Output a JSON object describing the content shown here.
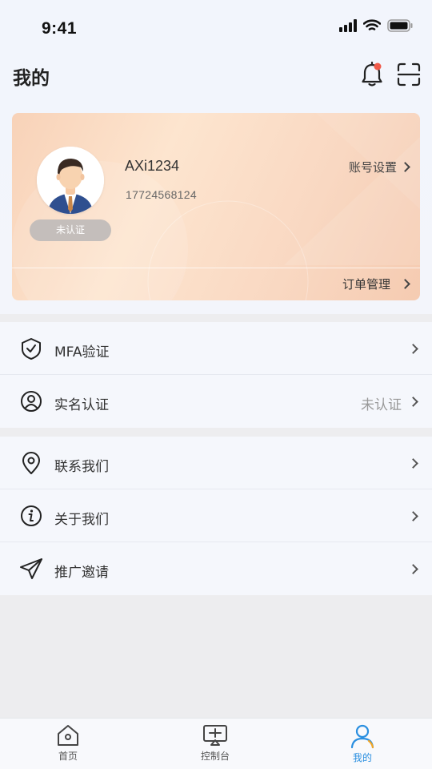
{
  "status_bar": {
    "time": "9:41"
  },
  "header": {
    "title": "我的",
    "bell_has_badge": true
  },
  "profile_card": {
    "username": "AXi1234",
    "phone": "17724568124",
    "verify_status": "未认证",
    "account_settings_label": "账号设置",
    "orders_label": "订单管理"
  },
  "menu_group_1": [
    {
      "icon": "shield-check-icon",
      "label": "MFA验证",
      "value": ""
    },
    {
      "icon": "user-circle-icon",
      "label": "实名认证",
      "value": "未认证"
    }
  ],
  "menu_group_2": [
    {
      "icon": "location-pin-icon",
      "label": "联系我们",
      "value": ""
    },
    {
      "icon": "info-icon",
      "label": "关于我们",
      "value": ""
    },
    {
      "icon": "paper-plane-icon",
      "label": "推广邀请",
      "value": ""
    }
  ],
  "tabbar": {
    "tabs": [
      {
        "label": "首页",
        "icon": "home-icon",
        "active": false
      },
      {
        "label": "控制台",
        "icon": "console-icon",
        "active": false
      },
      {
        "label": "我的",
        "icon": "profile-icon",
        "active": true
      }
    ]
  },
  "colors": {
    "accent": "#2a8fe0",
    "badge": "#f05a4a",
    "card_gradient_start": "#f8d2b8",
    "card_gradient_end": "#f5cbb1"
  }
}
